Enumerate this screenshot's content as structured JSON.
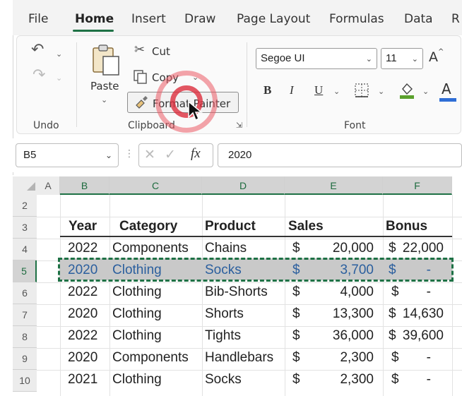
{
  "tabs": [
    "File",
    "Home",
    "Insert",
    "Draw",
    "Page Layout",
    "Formulas",
    "Data",
    "R"
  ],
  "ribbon": {
    "undo_group_label": "Undo",
    "clipboard_group_label": "Clipboard",
    "font_group_label": "Font",
    "paste_label": "Paste",
    "cut_label": "Cut",
    "copy_label": "Copy",
    "format_painter_label": "Format Painter",
    "font_name": "Segoe UI",
    "font_size": "11",
    "bold": "B",
    "italic": "I",
    "underline": "U",
    "grow_font": "A",
    "font_color": "A"
  },
  "formula_bar": {
    "name_box": "B5",
    "formula": "2020",
    "fx": "fx"
  },
  "columns": [
    "A",
    "B",
    "C",
    "D",
    "E",
    "F"
  ],
  "rows": [
    "2",
    "3",
    "4",
    "5",
    "6",
    "7",
    "8",
    "9",
    "10"
  ],
  "table": {
    "headers": [
      "Year",
      "Category",
      "Product",
      "Sales",
      "Bonus"
    ],
    "rows": [
      {
        "year": "2022",
        "category": "Components",
        "product": "Chains",
        "cur": "$",
        "sales": "20,000",
        "bcur": "$",
        "bonus": "22,000"
      },
      {
        "year": "2020",
        "category": "Clothing",
        "product": "Socks",
        "cur": "$",
        "sales": "3,700",
        "bcur": "$",
        "bonus": "-"
      },
      {
        "year": "2022",
        "category": "Clothing",
        "product": "Bib-Shorts",
        "cur": "$",
        "sales": "4,000",
        "bcur": "$",
        "bonus": "-"
      },
      {
        "year": "2020",
        "category": "Clothing",
        "product": "Shorts",
        "cur": "$",
        "sales": "13,300",
        "bcur": "$",
        "bonus": "14,630"
      },
      {
        "year": "2022",
        "category": "Clothing",
        "product": "Tights",
        "cur": "$",
        "sales": "36,000",
        "bcur": "$",
        "bonus": "39,600"
      },
      {
        "year": "2020",
        "category": "Components",
        "product": "Handlebars",
        "cur": "$",
        "sales": "2,300",
        "bcur": "$",
        "bonus": "-"
      },
      {
        "year": "2021",
        "category": "Clothing",
        "product": "Socks",
        "cur": "$",
        "sales": "2,300",
        "bcur": "$",
        "bonus": "-"
      }
    ]
  },
  "colors": {
    "accent": "#1e7145",
    "selected_text": "#2b5f9e",
    "highlight_ring": "#dc2d3c"
  }
}
